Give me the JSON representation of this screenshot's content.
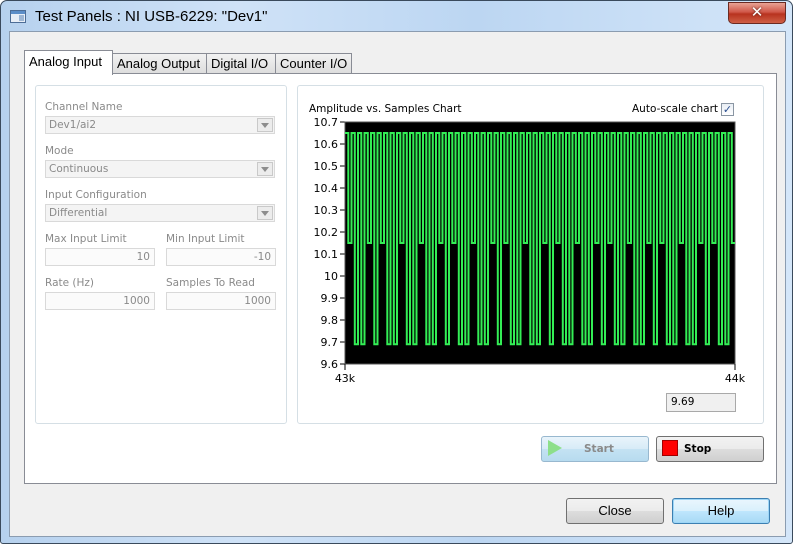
{
  "window": {
    "title": "Test Panels : NI USB-6229: \"Dev1\"",
    "close_glyph": "✕"
  },
  "tabs": [
    {
      "label": "Analog Input",
      "active": true
    },
    {
      "label": "Analog Output",
      "active": false
    },
    {
      "label": "Digital I/O",
      "active": false
    },
    {
      "label": "Counter I/O",
      "active": false
    }
  ],
  "settings": {
    "channel_name": {
      "label": "Channel Name",
      "value": "Dev1/ai2"
    },
    "mode": {
      "label": "Mode",
      "value": "Continuous"
    },
    "input_configuration": {
      "label": "Input Configuration",
      "value": "Differential"
    },
    "max_input_limit": {
      "label": "Max Input Limit",
      "value": "10"
    },
    "min_input_limit": {
      "label": "Min Input Limit",
      "value": "-10"
    },
    "rate": {
      "label": "Rate (Hz)",
      "value": "1000"
    },
    "samples_to_read": {
      "label": "Samples To Read",
      "value": "1000"
    }
  },
  "chart_panel": {
    "title": "Amplitude vs. Samples Chart",
    "autoscale_label": "Auto-scale chart",
    "autoscale_checked": true,
    "check_glyph": "✓",
    "current_value": "9.69"
  },
  "chart_data": {
    "type": "line",
    "title": "Amplitude vs. Samples Chart",
    "xlabel": "",
    "ylabel": "",
    "xlim": [
      43000,
      44000
    ],
    "ylim": [
      9.6,
      10.7
    ],
    "x_tick_labels": [
      "43k",
      "44k"
    ],
    "y_ticks": [
      10.7,
      10.6,
      10.5,
      10.4,
      10.3,
      10.2,
      10.1,
      10,
      9.9,
      9.8,
      9.7,
      9.6
    ],
    "y_tick_labels": [
      "10.7",
      "10.6",
      "10.5",
      "10.4",
      "10.3",
      "10.2",
      "10.1",
      "10",
      "9.9",
      "9.8",
      "9.7",
      "9.6"
    ],
    "grid": false,
    "background": "#000000",
    "line_color": "#33ee55",
    "series": [
      {
        "name": "Dev1/ai2",
        "description": "square-wave-like signal alternating among ~10.65 (high), ~10.15 (mid) and ~9.69 (low)",
        "levels": {
          "high": 10.65,
          "mid": 10.15,
          "low": 9.69
        },
        "pattern": [
          "H",
          "M",
          "H",
          "L",
          "H",
          "L",
          "H",
          "M",
          "H",
          "L",
          "H",
          "M",
          "H",
          "L",
          "H",
          "L",
          "H",
          "M",
          "H",
          "L",
          "H",
          "L",
          "H",
          "M",
          "H",
          "L",
          "H",
          "L",
          "H",
          "M",
          "H",
          "L",
          "H",
          "M",
          "H",
          "L",
          "H",
          "L",
          "H",
          "M",
          "H",
          "L",
          "H",
          "L",
          "H",
          "M",
          "H",
          "L",
          "H",
          "M",
          "H",
          "L",
          "H",
          "L",
          "H",
          "M",
          "H",
          "L",
          "H",
          "L",
          "H",
          "M",
          "H",
          "L",
          "H",
          "M",
          "H",
          "L",
          "H",
          "L",
          "H",
          "M",
          "H",
          "L",
          "H",
          "L",
          "H",
          "M",
          "H",
          "L",
          "H",
          "M",
          "H",
          "L",
          "H",
          "L",
          "H",
          "M",
          "H",
          "L",
          "H",
          "L",
          "H",
          "M",
          "H",
          "L",
          "H",
          "M",
          "H",
          "L",
          "H",
          "L",
          "H",
          "M",
          "H",
          "L",
          "H",
          "L",
          "H",
          "M",
          "H",
          "L",
          "H",
          "M",
          "H",
          "L",
          "H",
          "L",
          "H",
          "M"
        ]
      }
    ]
  },
  "buttons": {
    "start": "Start",
    "stop": "Stop",
    "close": "Close",
    "help": "Help"
  },
  "colors": {
    "trace": "#33ee55",
    "plot_bg": "#000000",
    "stop_icon": "#ff0000",
    "start_icon": "#8ddf8a"
  }
}
